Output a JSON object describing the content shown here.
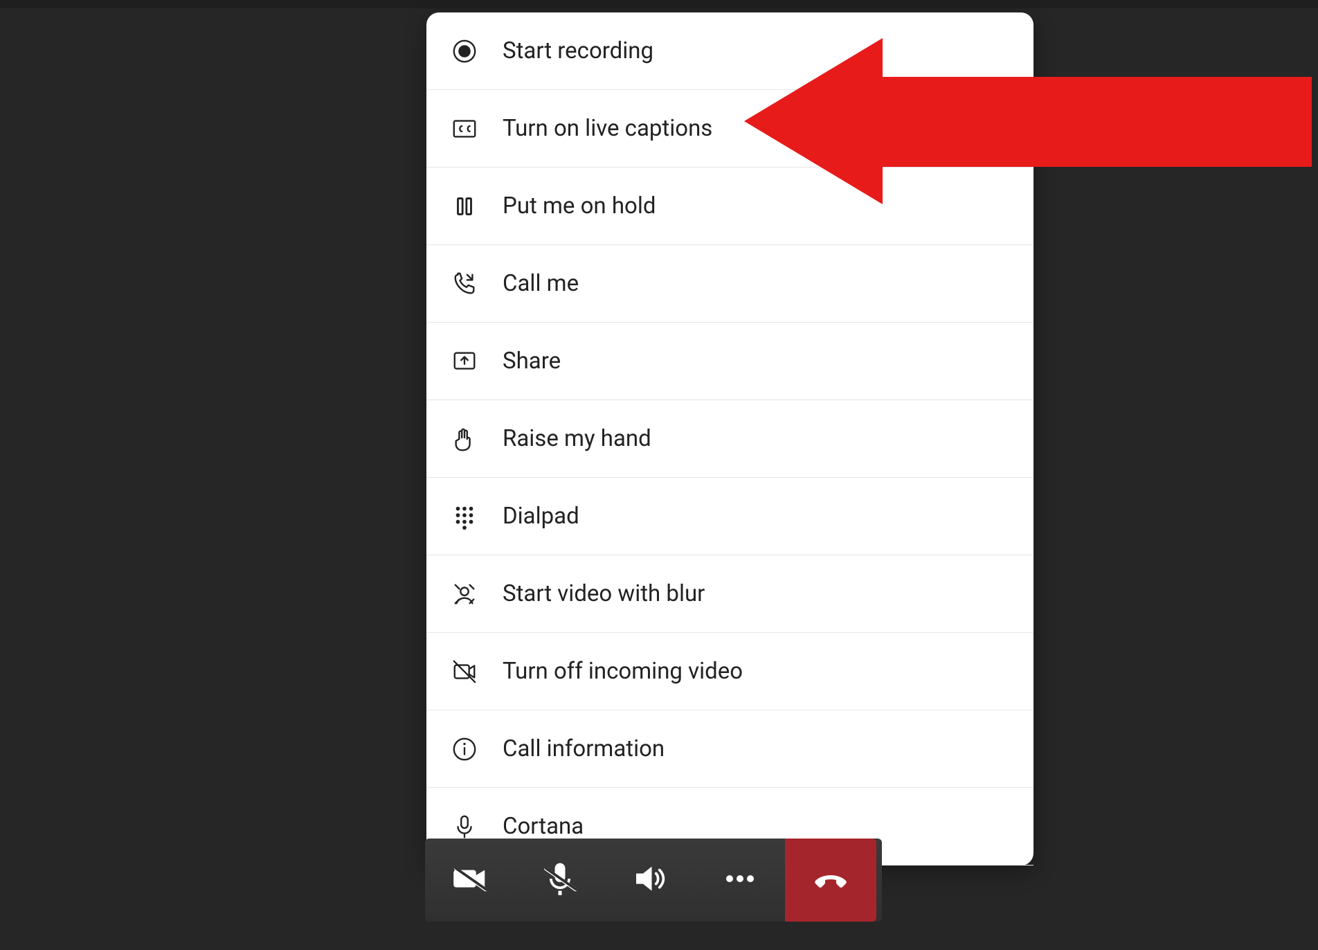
{
  "menu": {
    "items": [
      {
        "label": "Start recording",
        "icon": "record-icon"
      },
      {
        "label": "Turn on live captions",
        "icon": "cc-icon"
      },
      {
        "label": "Put me on hold",
        "icon": "pause-icon"
      },
      {
        "label": "Call me",
        "icon": "phone-callback-icon"
      },
      {
        "label": "Share",
        "icon": "share-screen-icon"
      },
      {
        "label": "Raise my hand",
        "icon": "raise-hand-icon"
      },
      {
        "label": "Dialpad",
        "icon": "dialpad-icon"
      },
      {
        "label": "Start video with blur",
        "icon": "video-blur-icon"
      },
      {
        "label": "Turn off incoming video",
        "icon": "incoming-video-off-icon"
      },
      {
        "label": "Call information",
        "icon": "info-icon"
      },
      {
        "label": "Cortana",
        "icon": "mic-icon"
      }
    ]
  },
  "annotation": {
    "arrow_target_label": "Turn on live captions",
    "arrow_color": "#e81b1b",
    "arrow_direction": "left"
  },
  "call_bar": {
    "buttons": [
      {
        "name": "camera-off-button",
        "icon": "camera-off-icon"
      },
      {
        "name": "mic-off-button",
        "icon": "mic-off-icon"
      },
      {
        "name": "speaker-button",
        "icon": "speaker-icon"
      },
      {
        "name": "more-actions-button",
        "icon": "more-icon"
      },
      {
        "name": "hangup-button",
        "icon": "hangup-icon"
      }
    ]
  },
  "colors": {
    "panel_bg": "#ffffff",
    "app_bg": "#262626",
    "hangup": "#a4262c"
  }
}
